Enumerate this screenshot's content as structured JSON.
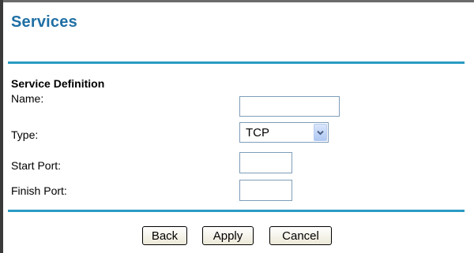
{
  "page": {
    "title": "Services"
  },
  "form": {
    "section_heading": "Service Definition",
    "name_label": "Name:",
    "name_value": "",
    "type_label": "Type:",
    "type_value": "TCP",
    "start_port_label": "Start Port:",
    "start_port_value": "",
    "finish_port_label": "Finish Port:",
    "finish_port_value": ""
  },
  "buttons": {
    "back": "Back",
    "apply": "Apply",
    "cancel": "Cancel"
  },
  "colors": {
    "title": "#1f6fa4",
    "rule": "#2a9bc4"
  }
}
